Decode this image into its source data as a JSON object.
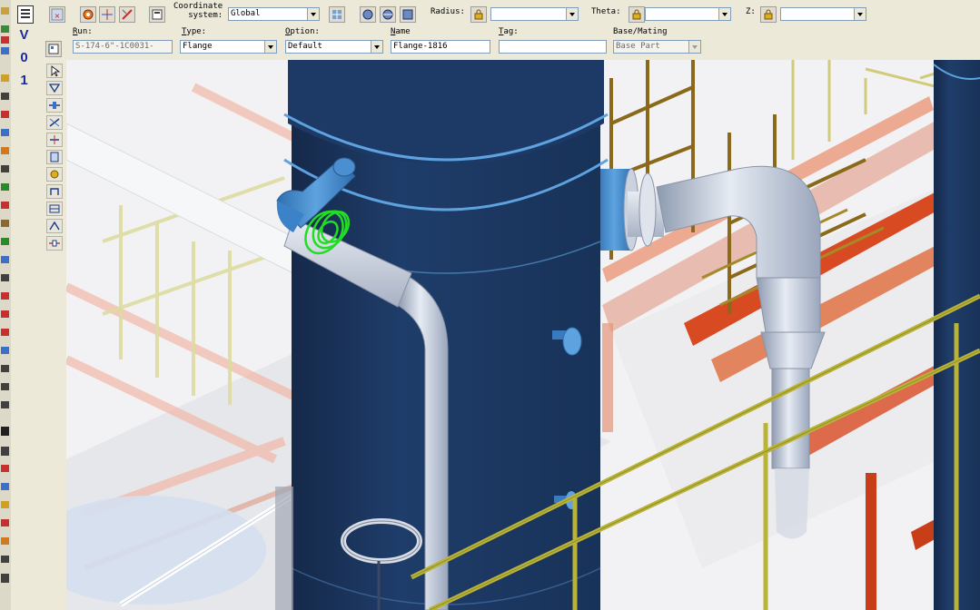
{
  "app": {
    "left_tab_chars": [
      "V",
      "0",
      "1"
    ]
  },
  "ribbon": {
    "coordinate_system": {
      "label_line1": "Coordinate",
      "label_line2": "system:",
      "value": "Global"
    },
    "radius": {
      "label": "Radius:",
      "value": ""
    },
    "theta": {
      "label": "Theta:",
      "value": ""
    },
    "z": {
      "label": "Z:",
      "value": ""
    },
    "run": {
      "label": "Run:",
      "value": "S-174-6\"-1C0031-"
    },
    "type": {
      "label": "Type:",
      "value": "Flange"
    },
    "option": {
      "label": "Option:",
      "value": "Default"
    },
    "name": {
      "label": "Name",
      "value": "Flange-1816"
    },
    "tag": {
      "label": "Tag:",
      "value": ""
    },
    "base_mating": {
      "label": "Base/Mating",
      "value": "Base Part"
    }
  },
  "icons": {
    "ribbon_buttons": [
      "cancel-selection-icon",
      "select-object-icon",
      "pick-point-icon",
      "toggle-ortho-icon",
      "properties-icon",
      "coordinate-refresh-icon",
      "view-front-icon",
      "view-side-icon",
      "view-top-icon",
      "lock-icon"
    ],
    "tools": [
      "select-arrow-icon",
      "route-pipe-icon",
      "insert-component-icon",
      "insert-tap-icon",
      "insert-split-icon",
      "pipe-spool-icon",
      "pipe-support-icon",
      "sequence-icon",
      "pipe-clamp-icon",
      "insert-feature-icon",
      "connect-icon"
    ]
  },
  "viewport": {
    "selected_object": "Flange-1816",
    "highlight_color": "#22dd22",
    "vessel_color": "#1d3a66",
    "pipe_color": "#c9d3e0",
    "railing_color": "#b9b338",
    "structure_color": "#d0502a"
  }
}
